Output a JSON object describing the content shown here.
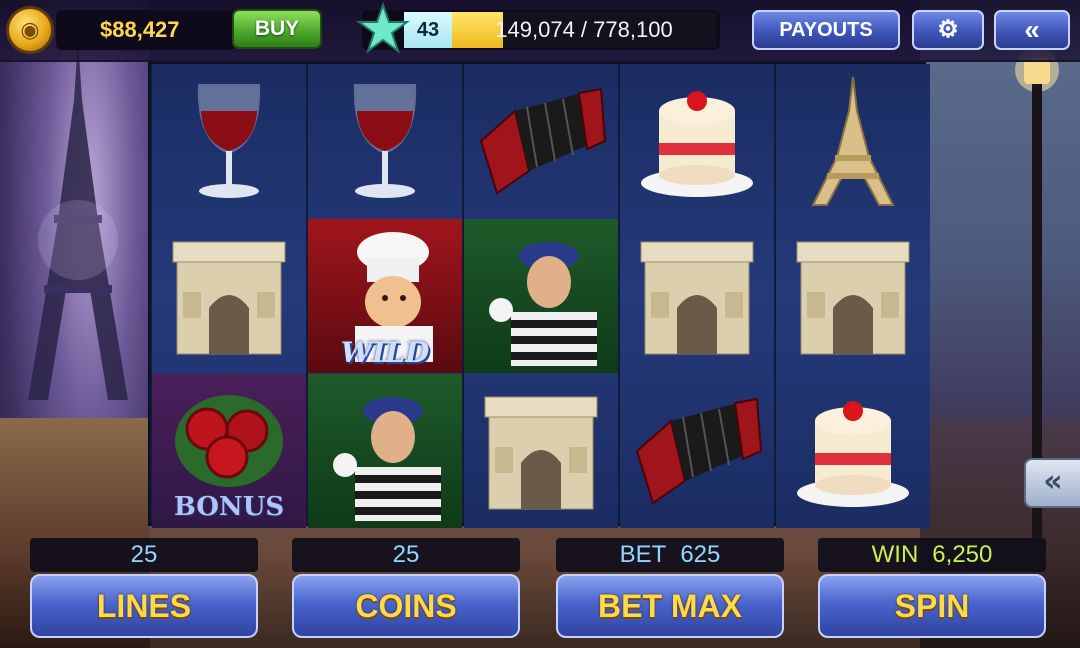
{
  "header": {
    "balance": "$88,427",
    "buy_label": "BUY",
    "level": "43",
    "xp_current": 149074,
    "xp_total": 778100,
    "xp_text": "149,074 / 778,100",
    "payouts_label": "PAYOUTS",
    "settings_icon": "gear-icon",
    "back_icon": "double-chevron-left-icon"
  },
  "reels": [
    [
      "wine-glass",
      "arc-de-triomphe",
      "roses-bonus"
    ],
    [
      "wine-glass",
      "chef-wild",
      "mime"
    ],
    [
      "accordion",
      "mime",
      "arc-de-triomphe"
    ],
    [
      "strawberry-cake",
      "arc-de-triomphe",
      "accordion"
    ],
    [
      "eiffel-tower",
      "arc-de-triomphe",
      "strawberry-cake"
    ]
  ],
  "symbol_labels": {
    "wild": "WILD",
    "bonus": "BONUS"
  },
  "controls": {
    "lines_value": "25",
    "coins_value": "25",
    "bet_label": "BET",
    "bet_value": "625",
    "win_label": "WIN",
    "win_value": "6,250",
    "lines_label": "LINES",
    "coins_label": "COINS",
    "bet_max_label": "BET MAX",
    "spin_label": "SPIN"
  },
  "side_arrow_icon": "double-chevron-left-icon",
  "colors": {
    "balance": "#ffd84a",
    "buy_button": "#4aa52a",
    "button_blue": "#4a64cc",
    "button_text": "#ffd94a",
    "win_text": "#c8f050",
    "value_text": "#8fd8ff"
  }
}
